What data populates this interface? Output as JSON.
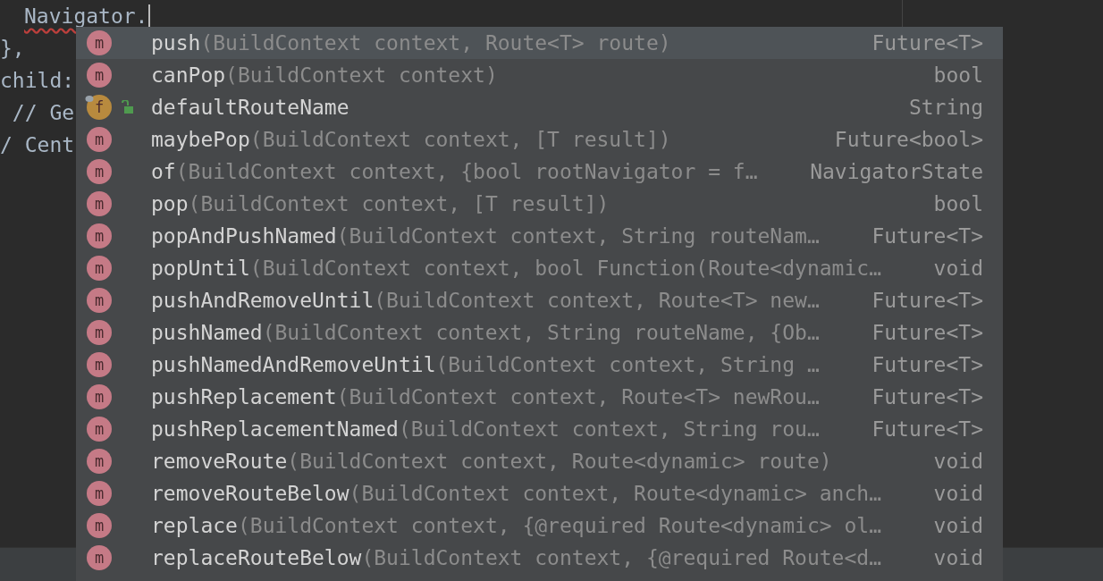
{
  "editor": {
    "lines": [
      {
        "text": "Navigator.",
        "indent": true,
        "error": true,
        "caret": true
      },
      {
        "text": "},",
        "indent": false,
        "error": false,
        "caret": false
      },
      {
        "text": "child:",
        "indent": false,
        "error": false,
        "caret": false
      },
      {
        "text": " // Ge",
        "indent": false,
        "error": false,
        "caret": false
      },
      {
        "text": "/ Cent",
        "indent": false,
        "error": false,
        "caret": false
      }
    ]
  },
  "completion": {
    "items": [
      {
        "kind": "method",
        "badge": "m",
        "name": "push",
        "params": "(BuildContext context, Route<T> route)",
        "type": "Future<T>",
        "selected": true
      },
      {
        "kind": "method",
        "badge": "m",
        "name": "canPop",
        "params": "(BuildContext context)",
        "type": "bool",
        "selected": false
      },
      {
        "kind": "field",
        "badge": "f",
        "name": "defaultRouteName",
        "type": "String",
        "selected": false
      },
      {
        "kind": "method",
        "badge": "m",
        "name": "maybePop",
        "params": "(BuildContext context, [T result])",
        "type": "Future<bool>",
        "selected": false
      },
      {
        "kind": "method",
        "badge": "m",
        "name": "of",
        "params": "(BuildContext context, {bool rootNavigator = f…",
        "type": "NavigatorState",
        "selected": false
      },
      {
        "kind": "method",
        "badge": "m",
        "name": "pop",
        "params": "(BuildContext context, [T result])",
        "type": "bool",
        "selected": false
      },
      {
        "kind": "method",
        "badge": "m",
        "name": "popAndPushNamed",
        "params": "(BuildContext context, String routeNam…",
        "type": "Future<T>",
        "selected": false
      },
      {
        "kind": "method",
        "badge": "m",
        "name": "popUntil",
        "params": "(BuildContext context, bool Function(Route<dynamic…",
        "type": "void",
        "selected": false
      },
      {
        "kind": "method",
        "badge": "m",
        "name": "pushAndRemoveUntil",
        "params": "(BuildContext context, Route<T> new…",
        "type": "Future<T>",
        "selected": false
      },
      {
        "kind": "method",
        "badge": "m",
        "name": "pushNamed",
        "params": "(BuildContext context, String routeName, {Ob…",
        "type": "Future<T>",
        "selected": false
      },
      {
        "kind": "method",
        "badge": "m",
        "name": "pushNamedAndRemoveUntil",
        "params": "(BuildContext context, String …",
        "type": "Future<T>",
        "selected": false
      },
      {
        "kind": "method",
        "badge": "m",
        "name": "pushReplacement",
        "params": "(BuildContext context, Route<T> newRou…",
        "type": "Future<T>",
        "selected": false
      },
      {
        "kind": "method",
        "badge": "m",
        "name": "pushReplacementNamed",
        "params": "(BuildContext context, String rou…",
        "type": "Future<T>",
        "selected": false
      },
      {
        "kind": "method",
        "badge": "m",
        "name": "removeRoute",
        "params": "(BuildContext context, Route<dynamic> route)",
        "type": "void",
        "selected": false
      },
      {
        "kind": "method",
        "badge": "m",
        "name": "removeRouteBelow",
        "params": "(BuildContext context, Route<dynamic> anch…",
        "type": "void",
        "selected": false
      },
      {
        "kind": "method",
        "badge": "m",
        "name": "replace",
        "params": "(BuildContext context, {@required Route<dynamic> ol…",
        "type": "void",
        "selected": false
      },
      {
        "kind": "method",
        "badge": "m",
        "name": "replaceRouteBelow",
        "params": "(BuildContext context, {@required Route<d…",
        "type": "void",
        "selected": false
      }
    ]
  }
}
